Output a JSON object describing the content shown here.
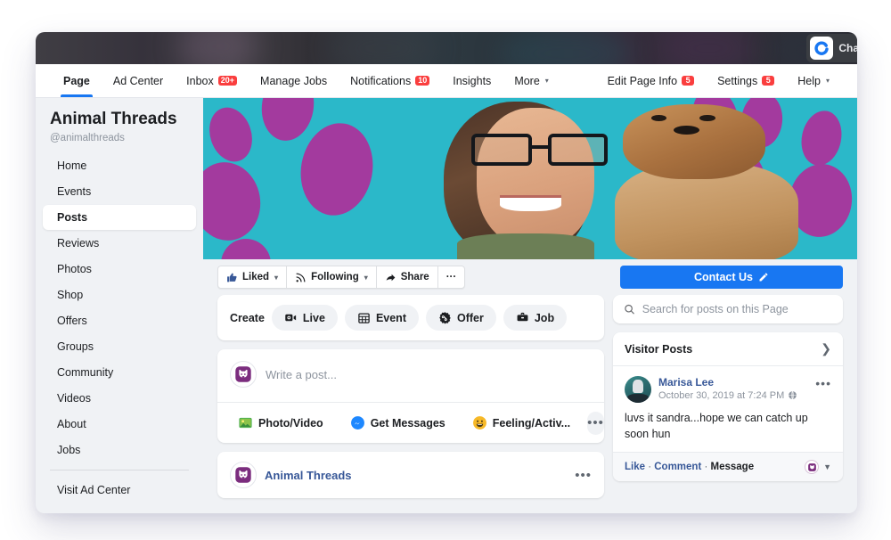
{
  "topbar": {
    "chat_widget": {
      "logo_icon": "chat-logo-c-icon",
      "label": "Chat",
      "logo_color": "#1877f2"
    }
  },
  "navbar": {
    "left_tabs": [
      {
        "label": "Page",
        "active": true,
        "badge": null,
        "caret": false
      },
      {
        "label": "Ad Center",
        "active": false,
        "badge": null,
        "caret": false
      },
      {
        "label": "Inbox",
        "active": false,
        "badge": "20+",
        "caret": false
      },
      {
        "label": "Manage Jobs",
        "active": false,
        "badge": null,
        "caret": false
      },
      {
        "label": "Notifications",
        "active": false,
        "badge": "10",
        "caret": false
      },
      {
        "label": "Insights",
        "active": false,
        "badge": null,
        "caret": false
      },
      {
        "label": "More",
        "active": false,
        "badge": null,
        "caret": true
      }
    ],
    "right_tabs": [
      {
        "label": "Edit Page Info",
        "badge": "5",
        "caret": false
      },
      {
        "label": "Settings",
        "badge": "5",
        "caret": false
      },
      {
        "label": "Help",
        "badge": null,
        "caret": true
      }
    ],
    "active_underline_color": "#1877f2",
    "badge_color": "#fa3e3e"
  },
  "sidebar": {
    "page_name": "Animal Threads",
    "page_handle": "@animalthreads",
    "items": [
      {
        "label": "Home",
        "active": false
      },
      {
        "label": "Events",
        "active": false
      },
      {
        "label": "Posts",
        "active": true
      },
      {
        "label": "Reviews",
        "active": false
      },
      {
        "label": "Photos",
        "active": false
      },
      {
        "label": "Shop",
        "active": false
      },
      {
        "label": "Offers",
        "active": false
      },
      {
        "label": "Groups",
        "active": false
      },
      {
        "label": "Community",
        "active": false
      },
      {
        "label": "Videos",
        "active": false
      },
      {
        "label": "About",
        "active": false
      },
      {
        "label": "Jobs",
        "active": false
      }
    ],
    "footer_link": "Visit Ad Center"
  },
  "cover": {
    "description": "Woman with black glasses holding a Yorkshire terrier in front of a teal wall with purple paw prints",
    "background_color": "#2bb8c9",
    "paw_color": "#a33a9e"
  },
  "actionbar": {
    "buttons": [
      {
        "label": "Liked",
        "icon": "thumbs-up-icon",
        "caret": true
      },
      {
        "label": "Following",
        "icon": "rss-icon",
        "caret": true
      },
      {
        "label": "Share",
        "icon": "share-arrow-icon",
        "caret": false
      },
      {
        "label": "···",
        "icon": "ellipsis-icon",
        "caret": false
      }
    ],
    "cta": {
      "label": "Contact Us",
      "icon": "pencil-icon",
      "color": "#1877f2"
    }
  },
  "create": {
    "label": "Create",
    "options": [
      {
        "label": "Live",
        "icon": "video-camera-icon"
      },
      {
        "label": "Event",
        "icon": "calendar-icon"
      },
      {
        "label": "Offer",
        "icon": "tag-icon"
      },
      {
        "label": "Job",
        "icon": "briefcase-icon"
      }
    ]
  },
  "composer": {
    "avatar_icon": "animal-threads-dog-avatar",
    "placeholder": "Write a post...",
    "actions": [
      {
        "label": "Photo/Video",
        "icon": "photo-video-icon"
      },
      {
        "label": "Get Messages",
        "icon": "messenger-icon"
      },
      {
        "label": "Feeling/Activ...",
        "icon": "smiley-icon"
      }
    ],
    "more_icon": "ellipsis-icon"
  },
  "page_post": {
    "avatar_icon": "animal-threads-dog-avatar",
    "author": "Animal Threads",
    "more_icon": "ellipsis-icon"
  },
  "search": {
    "icon": "search-icon",
    "placeholder": "Search for posts on this Page",
    "value": ""
  },
  "visitor_posts": {
    "title": "Visitor Posts",
    "chevron_icon": "chevron-right-icon",
    "posts": [
      {
        "author": "Marisa Lee",
        "timestamp": "October 30, 2019 at 7:24 PM",
        "privacy_icon": "globe-icon",
        "body": "luvs it sandra...hope we can catch up soon hun",
        "more_icon": "ellipsis-icon",
        "footer_links": [
          "Like",
          "Comment",
          "Message"
        ],
        "reaction_avatar_icon": "animal-threads-dog-avatar",
        "reaction_chevron_icon": "chevron-down-icon"
      }
    ]
  }
}
